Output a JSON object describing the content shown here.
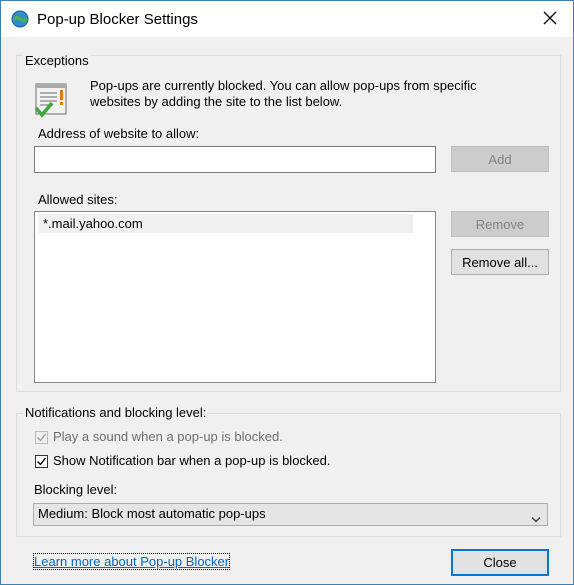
{
  "window": {
    "title": "Pop-up Blocker Settings"
  },
  "exceptions": {
    "group_title": "Exceptions",
    "info_text": "Pop-ups are currently blocked.  You can allow pop-ups from specific websites by adding the site to the list below.",
    "address_label": "Address of website to allow:",
    "address_value": "",
    "add_label": "Add",
    "allowed_label": "Allowed sites:",
    "allowed_sites": [
      "*.mail.yahoo.com"
    ],
    "remove_label": "Remove",
    "remove_all_label": "Remove all..."
  },
  "notifications": {
    "group_title": "Notifications and blocking level:",
    "play_sound_label": "Play a sound when a pop-up is blocked.",
    "play_sound_checked": true,
    "show_bar_label": "Show Notification bar when a pop-up is blocked.",
    "show_bar_checked": true,
    "blocking_level_label": "Blocking level:",
    "blocking_level_value": "Medium: Block most automatic pop-ups"
  },
  "footer": {
    "learn_more": "Learn more about Pop-up Blocker",
    "close_label": "Close"
  }
}
